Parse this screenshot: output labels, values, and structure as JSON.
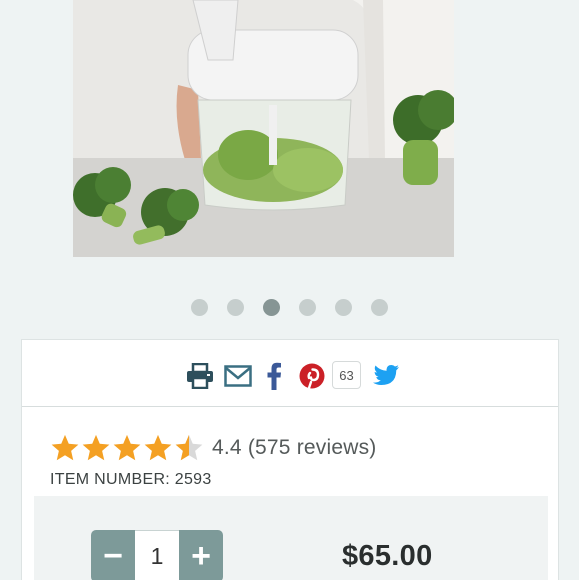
{
  "product": {
    "image": {
      "name": "manual food chopper with broccoli"
    },
    "carousel": {
      "count": 6,
      "active_index": 2
    }
  },
  "share": {
    "icons": [
      "print-icon",
      "mail-icon",
      "facebook-icon",
      "pinterest-icon",
      "twitter-icon"
    ],
    "pin_count": "63",
    "colors": {
      "print": "#2d4f5c",
      "mail": "#3a6f82",
      "facebook": "#3b5998",
      "pinterest": "#cb2027",
      "twitter": "#1da1f2"
    }
  },
  "rating": {
    "stars": 4.4,
    "max_stars": 5,
    "text": "4.4 (575 reviews)",
    "star_color": "#f4a023"
  },
  "item_number": "ITEM NUMBER: 2593",
  "purchase": {
    "quantity": "1",
    "minus_label": "−",
    "plus_label": "+",
    "price": "$65.00",
    "accent": "#7d9a99"
  }
}
